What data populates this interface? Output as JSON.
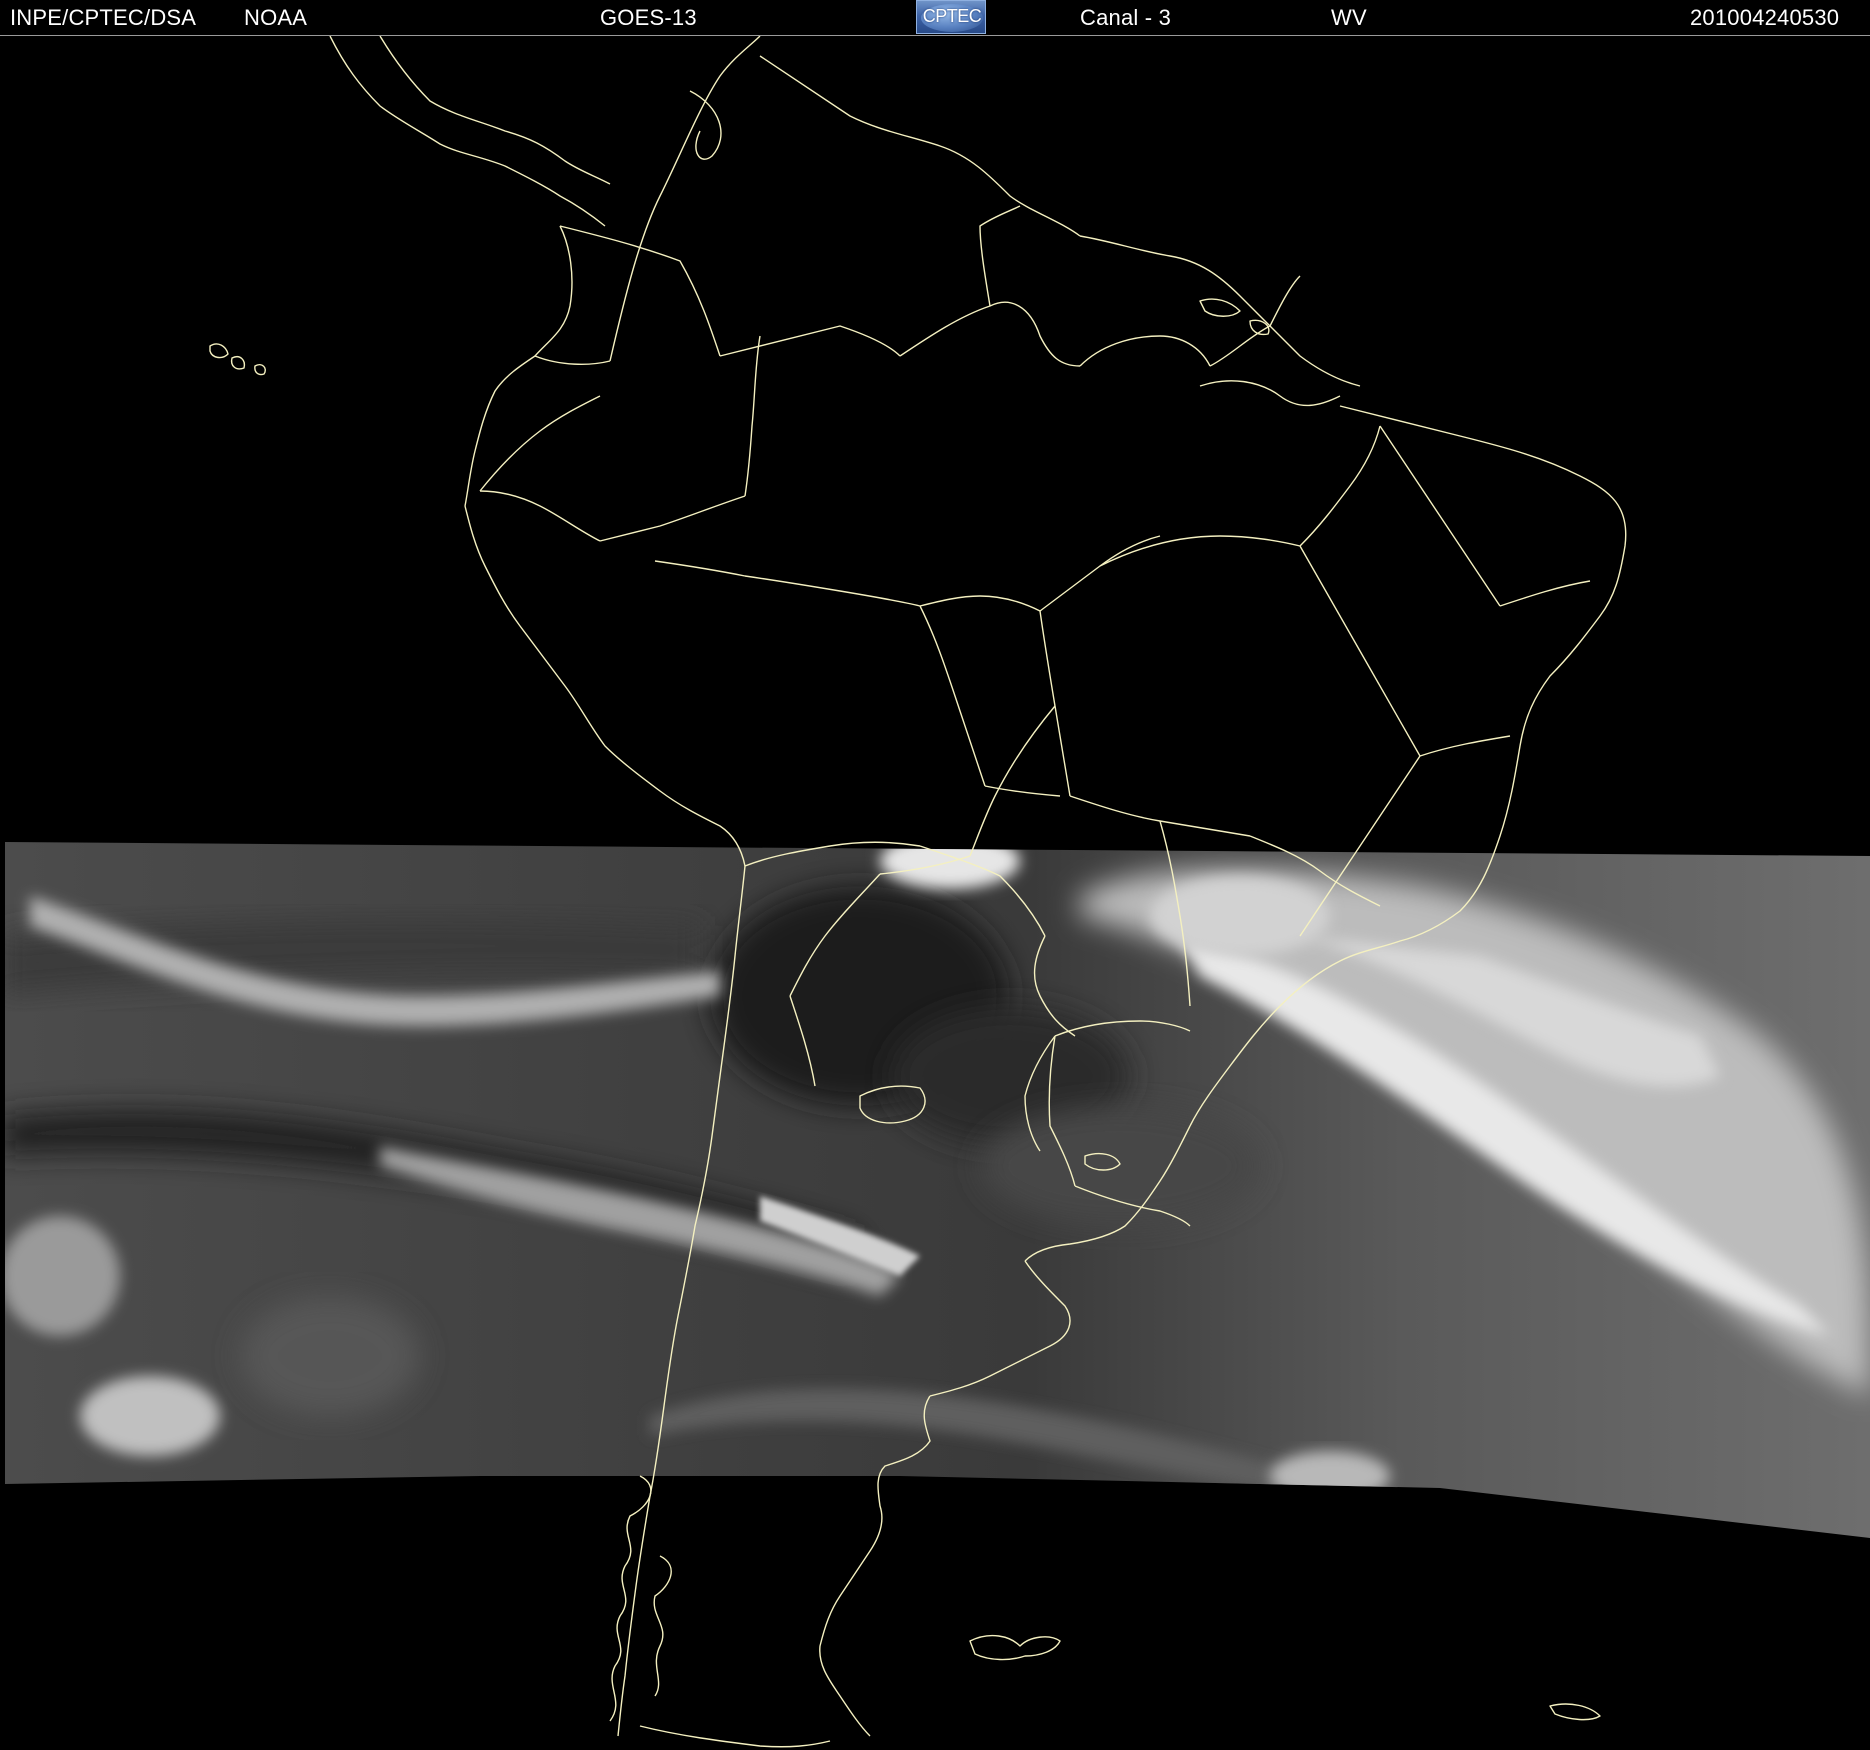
{
  "header": {
    "organization": "INPE/CPTEC/DSA",
    "agency": "NOAA",
    "satellite": "GOES-13",
    "logo_text": "CPTEC",
    "channel": "Canal - 3",
    "band": "WV",
    "timestamp": "201004240530"
  },
  "map": {
    "image_type": "water-vapor satellite imagery",
    "region": "South America",
    "coastline_color": "#f4f0c0",
    "background_color": "#000000"
  }
}
